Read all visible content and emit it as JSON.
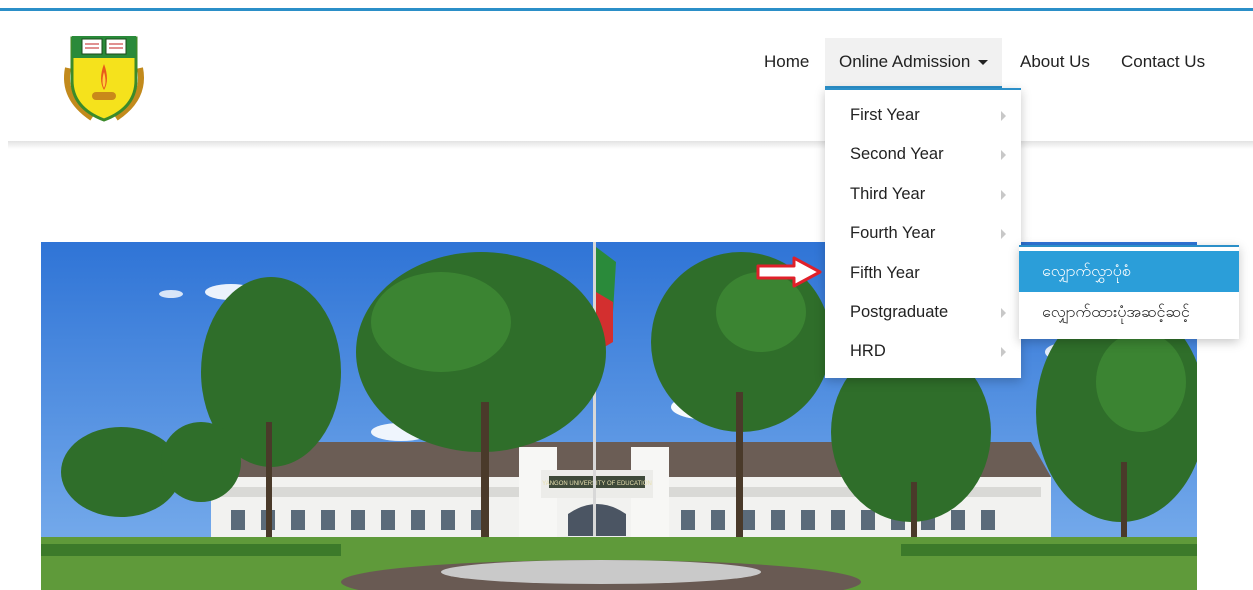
{
  "nav": {
    "items": [
      {
        "label": "Home"
      },
      {
        "label": "Online Admission"
      },
      {
        "label": "About Us"
      },
      {
        "label": "Contact Us"
      }
    ]
  },
  "dropdown": {
    "items": [
      {
        "label": "First Year"
      },
      {
        "label": "Second Year"
      },
      {
        "label": "Third Year"
      },
      {
        "label": "Fourth Year"
      },
      {
        "label": "Fifth Year"
      },
      {
        "label": "Postgraduate"
      },
      {
        "label": "HRD"
      }
    ]
  },
  "submenu": {
    "items": [
      {
        "label": "လျှောက်လွှာပုံစံ"
      },
      {
        "label": "လျှောက်ထားပုံအဆင့်ဆင့်"
      }
    ]
  },
  "banner": {
    "building_sign": "YANGON UNIVERSITY OF EDUCATION"
  },
  "colors": {
    "accent": "#2b8fc8",
    "submenu_highlight": "#2b9ed9",
    "pointer_arrow": "#e0202a"
  },
  "icons": [
    "university-logo-icon",
    "caret-down-icon",
    "chevron-right-icon",
    "red-pointer-arrow-icon"
  ]
}
